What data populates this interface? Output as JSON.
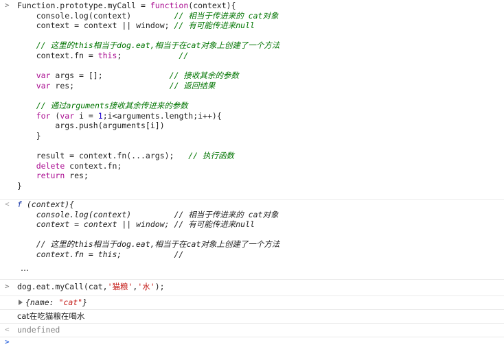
{
  "console": {
    "entry1": {
      "prompt": ">",
      "lines": [
        [
          [
            "plain",
            "Function.prototype.myCall = "
          ],
          [
            "kw",
            "function"
          ],
          [
            "plain",
            "(context){"
          ]
        ],
        [
          [
            "plain",
            "    console.log(context)         "
          ],
          [
            "cm",
            "// 相当于传进来的 cat对象"
          ]
        ],
        [
          [
            "plain",
            "    context = context || window; "
          ],
          [
            "cm",
            "// 有可能传进来null"
          ]
        ],
        [
          [
            "plain",
            ""
          ]
        ],
        [
          [
            "cm",
            "    // 这里的this相当于dog.eat,相当于在cat对象上创建了一个方法"
          ]
        ],
        [
          [
            "plain",
            "    context.fn = "
          ],
          [
            "kw",
            "this"
          ],
          [
            "plain",
            ";            "
          ],
          [
            "cm",
            "//"
          ]
        ],
        [
          [
            "plain",
            ""
          ]
        ],
        [
          [
            "plain",
            "    "
          ],
          [
            "kw",
            "var"
          ],
          [
            "plain",
            " args = [];              "
          ],
          [
            "cm",
            "// 接收其余的参数"
          ]
        ],
        [
          [
            "plain",
            "    "
          ],
          [
            "kw",
            "var"
          ],
          [
            "plain",
            " res;                    "
          ],
          [
            "cm",
            "// 返回结果"
          ]
        ],
        [
          [
            "plain",
            ""
          ]
        ],
        [
          [
            "cm",
            "    // 通过arguments接收其余传进来的参数"
          ]
        ],
        [
          [
            "plain",
            "    "
          ],
          [
            "kw",
            "for"
          ],
          [
            "plain",
            " ("
          ],
          [
            "kw",
            "var"
          ],
          [
            "plain",
            " i = "
          ],
          [
            "num",
            "1"
          ],
          [
            "plain",
            ";i<arguments.length;i++){"
          ]
        ],
        [
          [
            "plain",
            "        args.push(arguments[i])"
          ]
        ],
        [
          [
            "plain",
            "    }"
          ]
        ],
        [
          [
            "plain",
            ""
          ]
        ],
        [
          [
            "plain",
            "    result = context.fn(...args);   "
          ],
          [
            "cm",
            "// 执行函数"
          ]
        ],
        [
          [
            "plain",
            "    "
          ],
          [
            "kw",
            "delete"
          ],
          [
            "plain",
            " context.fn;"
          ]
        ],
        [
          [
            "plain",
            "    "
          ],
          [
            "kw",
            "return"
          ],
          [
            "plain",
            " res;"
          ]
        ],
        [
          [
            "plain",
            "}"
          ]
        ]
      ]
    },
    "entry2": {
      "prompt": "<",
      "lines": [
        [
          [
            "fn-f",
            "f"
          ],
          [
            "italic",
            " (context){"
          ]
        ],
        [
          [
            "italic",
            "    console.log(context)         // 相当于传进来的 cat对象"
          ]
        ],
        [
          [
            "italic",
            "    context = context || window; // 有可能传进来null"
          ]
        ],
        [
          [
            "italic",
            ""
          ]
        ],
        [
          [
            "italic",
            "    // 这里的this相当于dog.eat,相当于在cat对象上创建了一个方法"
          ]
        ],
        [
          [
            "italic",
            "    context.fn = this;           //"
          ]
        ]
      ],
      "ellipsis": "…"
    },
    "entry3": {
      "prompt": ">",
      "lines": [
        [
          [
            "plain",
            "dog.eat.myCall(cat,"
          ],
          [
            "str",
            "'猫粮'"
          ],
          [
            "plain",
            ","
          ],
          [
            "str",
            "'水'"
          ],
          [
            "plain",
            ");"
          ]
        ]
      ]
    },
    "entry4": {
      "object_prefix": "{name: ",
      "object_value": "\"cat\"",
      "object_suffix": "}"
    },
    "entry5": {
      "log_text": "cat在吃猫粮在喝水"
    },
    "entry6": {
      "prompt": "<",
      "result": "undefined"
    },
    "entry7": {
      "prompt": ">"
    }
  },
  "colors": {
    "keyword": "#aa0d91",
    "string": "#c41a16",
    "number": "#1c00cf",
    "comment": "#007400",
    "prompt_active": "#3b6fe0"
  }
}
